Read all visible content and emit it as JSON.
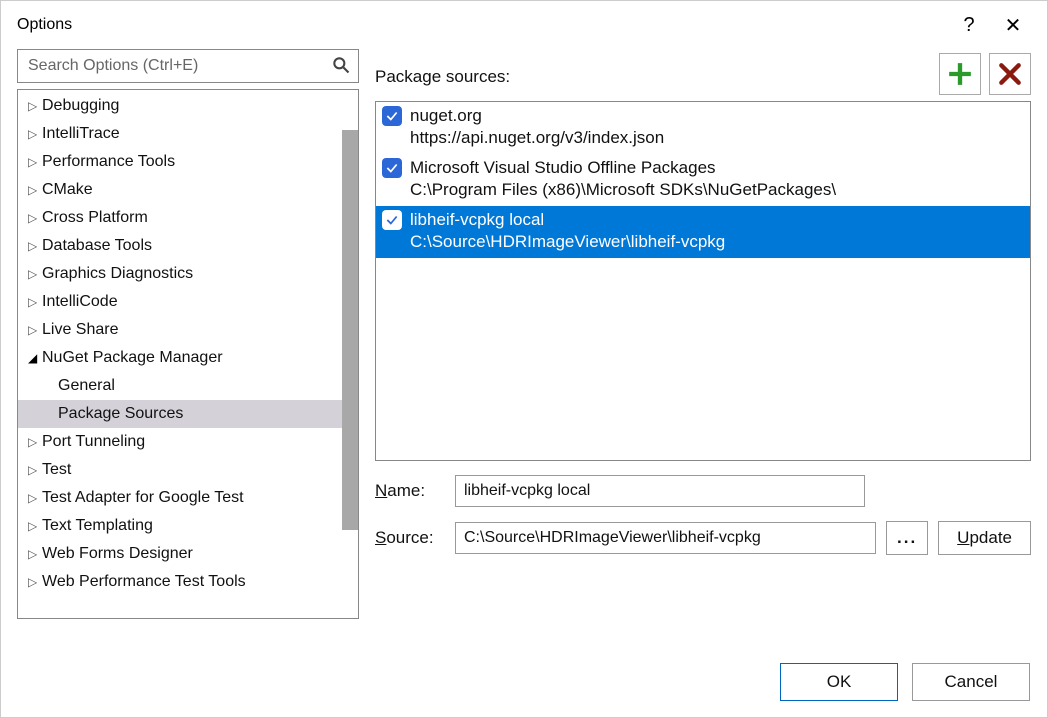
{
  "window": {
    "title": "Options",
    "help": "?",
    "close": "✕"
  },
  "search": {
    "placeholder": "Search Options (Ctrl+E)"
  },
  "tree": [
    {
      "label": "Debugging",
      "expanded": false
    },
    {
      "label": "IntelliTrace",
      "expanded": false
    },
    {
      "label": "Performance Tools",
      "expanded": false
    },
    {
      "label": "CMake",
      "expanded": false
    },
    {
      "label": "Cross Platform",
      "expanded": false
    },
    {
      "label": "Database Tools",
      "expanded": false
    },
    {
      "label": "Graphics Diagnostics",
      "expanded": false
    },
    {
      "label": "IntelliCode",
      "expanded": false
    },
    {
      "label": "Live Share",
      "expanded": false
    },
    {
      "label": "NuGet Package Manager",
      "expanded": true,
      "children": [
        {
          "label": "General",
          "selected": false
        },
        {
          "label": "Package Sources",
          "selected": true
        }
      ]
    },
    {
      "label": "Port Tunneling",
      "expanded": false
    },
    {
      "label": "Test",
      "expanded": false
    },
    {
      "label": "Test Adapter for Google Test",
      "expanded": false
    },
    {
      "label": "Text Templating",
      "expanded": false
    },
    {
      "label": "Web Forms Designer",
      "expanded": false
    },
    {
      "label": "Web Performance Test Tools",
      "expanded": false
    }
  ],
  "packageSources": {
    "headerLabel": "Package sources:",
    "items": [
      {
        "name": "nuget.org",
        "url": "https://api.nuget.org/v3/index.json",
        "checked": true,
        "selected": false
      },
      {
        "name": "Microsoft Visual Studio Offline Packages",
        "url": "C:\\Program Files (x86)\\Microsoft SDKs\\NuGetPackages\\",
        "checked": true,
        "selected": false
      },
      {
        "name": "libheif-vcpkg local",
        "url": "C:\\Source\\HDRImageViewer\\libheif-vcpkg",
        "checked": true,
        "selected": true
      }
    ]
  },
  "form": {
    "nameLabel": "ame:",
    "nameLabelPrefix": "N",
    "nameValue": "libheif-vcpkg local",
    "sourceLabel": "ource:",
    "sourceLabelPrefix": "S",
    "sourceValue": "C:\\Source\\HDRImageViewer\\libheif-vcpkg",
    "browseLabel": "...",
    "updateLabel": "pdate",
    "updateLabelPrefix": "U"
  },
  "footer": {
    "ok": "OK",
    "cancel": "Cancel"
  },
  "colors": {
    "selectionBlue": "#0078d7",
    "checkboxBlue": "#2b67d7",
    "addGreen": "#2a9a2a",
    "removeRed": "#8a1a0e"
  }
}
